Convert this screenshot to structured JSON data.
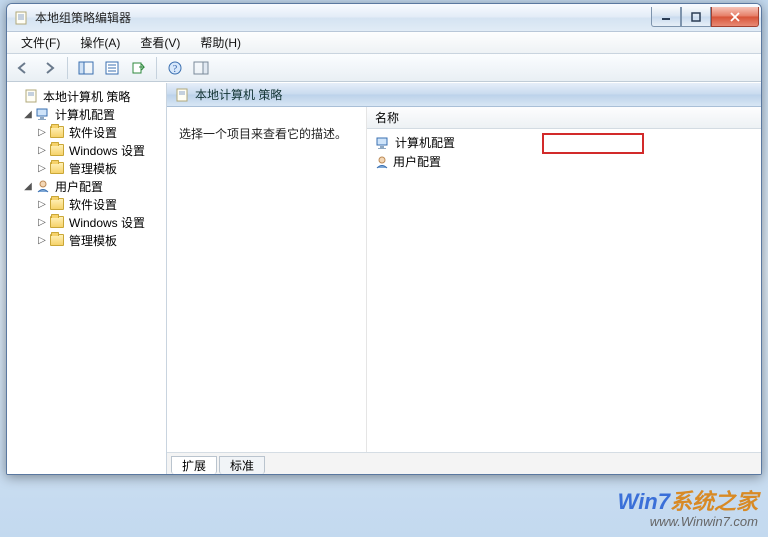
{
  "window": {
    "title": "本地组策略编辑器"
  },
  "menu": {
    "file": "文件(F)",
    "action": "操作(A)",
    "view": "查看(V)",
    "help": "帮助(H)"
  },
  "tree": {
    "root": "本地计算机 策略",
    "computer": {
      "label": "计算机配置",
      "software": "软件设置",
      "windows": "Windows 设置",
      "templates": "管理模板"
    },
    "user": {
      "label": "用户配置",
      "software": "软件设置",
      "windows": "Windows 设置",
      "templates": "管理模板"
    }
  },
  "right": {
    "header": "本地计算机 策略",
    "description": "选择一个项目来查看它的描述。",
    "column_name": "名称",
    "items": {
      "computer": "计算机配置",
      "user": "用户配置"
    }
  },
  "tabs": {
    "extended": "扩展",
    "standard": "标准"
  },
  "watermark": {
    "w7": "Win7",
    "brand": "系统之家",
    "url": "www.Winwin7.com"
  }
}
